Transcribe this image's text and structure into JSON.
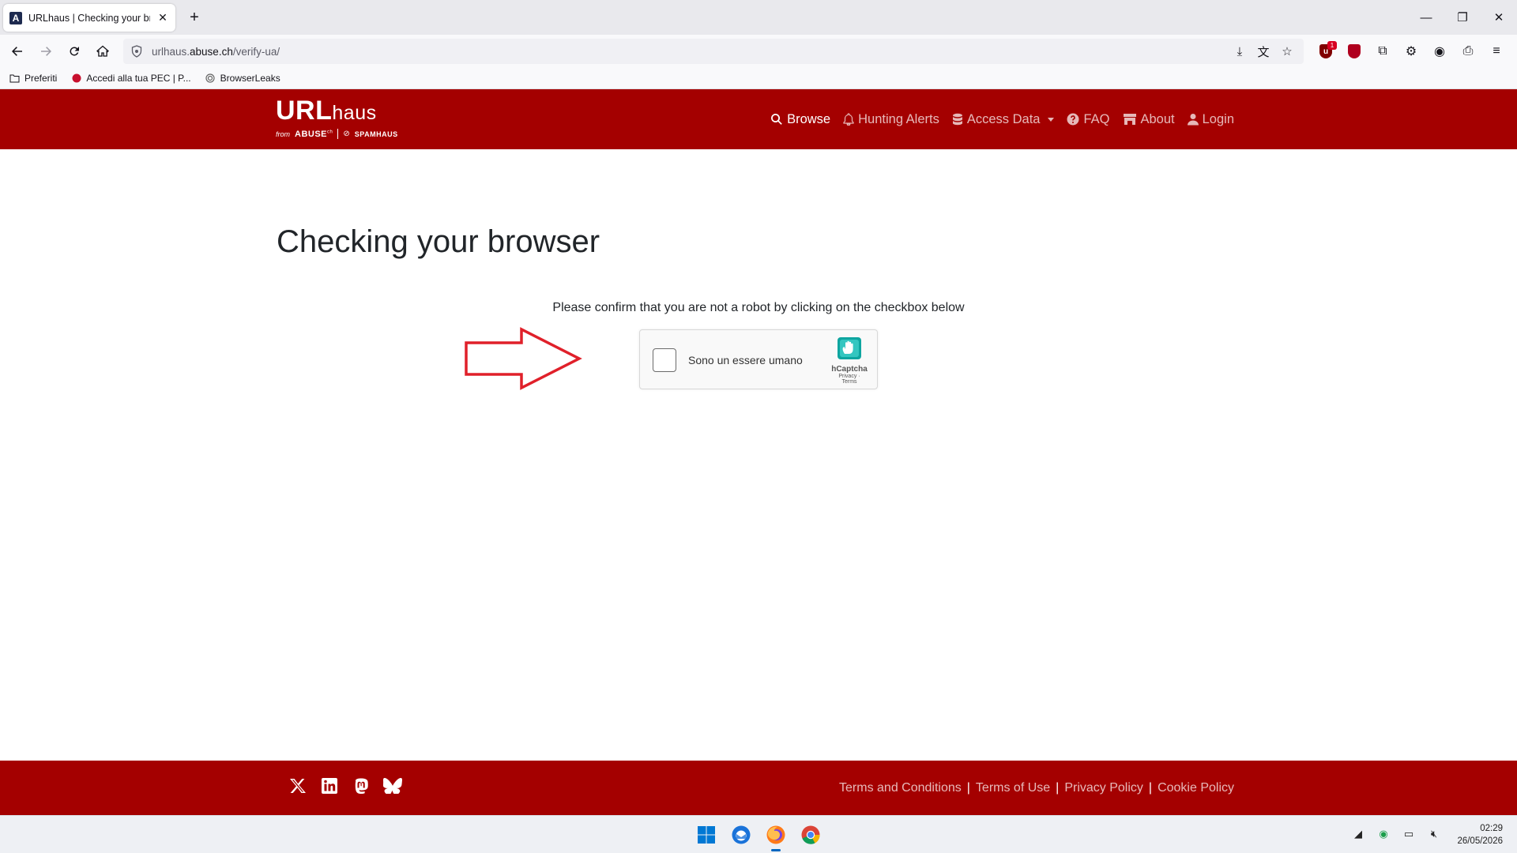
{
  "browser": {
    "tab_title": "URLhaus | Checking your browser",
    "tab_favicon": "A",
    "url_prefix": "urlhaus.",
    "url_domain": "abuse.ch",
    "url_path": "/verify-ua/",
    "extension_badge": "1",
    "bookmarks": [
      {
        "label": "Preferiti"
      },
      {
        "label": "Accedi alla tua PEC | P..."
      },
      {
        "label": "BrowserLeaks"
      }
    ]
  },
  "site": {
    "logo_main": "URL",
    "logo_haus": "haus",
    "logo_from": "from",
    "logo_abuse": "ABUSE",
    "logo_abuse_sup": "ch",
    "logo_spamhaus": "SPAMHAUS",
    "nav": {
      "browse": "Browse",
      "hunting_alerts": "Hunting Alerts",
      "access_data": "Access Data",
      "faq": "FAQ",
      "about": "About",
      "login": "Login"
    },
    "accent_color": "#a40000"
  },
  "main": {
    "title": "Checking your browser",
    "instruction": "Please confirm that you are not a robot by clicking on the checkbox below"
  },
  "captcha": {
    "label": "Sono un essere umano",
    "brand": "hCaptcha",
    "privacy": "Privacy",
    "terms": "Terms"
  },
  "footer": {
    "links": {
      "terms_conditions": "Terms and Conditions",
      "terms_use": "Terms of Use",
      "privacy": "Privacy Policy",
      "cookie": "Cookie Policy"
    },
    "separator": "|"
  },
  "taskbar": {
    "time": "02:29",
    "date": "26/05/2026"
  }
}
